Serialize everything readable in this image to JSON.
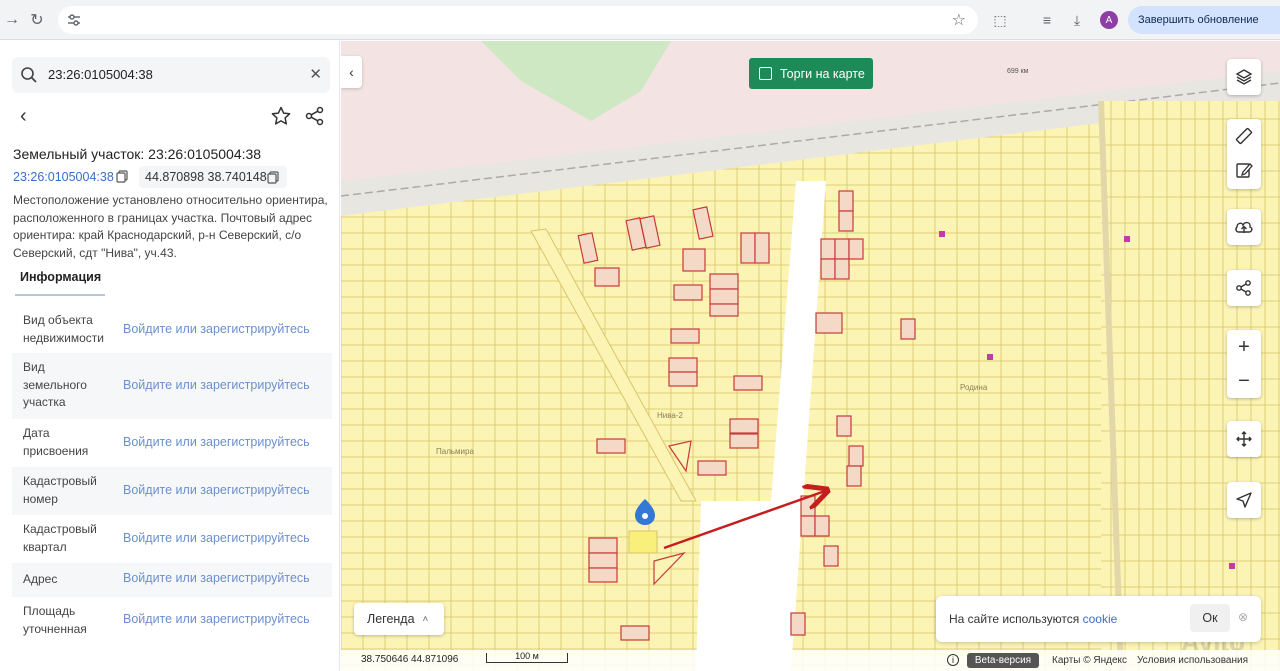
{
  "browser": {
    "update_button": "Завершить обновление",
    "avatar_letter": "A"
  },
  "panel": {
    "search_query": "23:26:0105004:38",
    "title": "Земельный участок: 23:26:0105004:38",
    "cadastral_link": "23:26:0105004:38",
    "coordinates": "44.870898 38.740148",
    "description": "Местоположение установлено относительно ориентира, расположенного в границах участка. Почтовый адрес ориентира: край Краснодарский, р-н Северский, с/о Северский, сдт \"Нива\", уч.43.",
    "tab_info": "Информация",
    "rows": [
      {
        "label": "Вид объекта недвижимости",
        "value": "Войдите или зарегистрируйтесь"
      },
      {
        "label": "Вид земельного участка",
        "value": "Войдите или зарегистрируйтесь"
      },
      {
        "label": "Дата присвоения",
        "value": "Войдите или зарегистрируйтесь"
      },
      {
        "label": "Кадастровый номер",
        "value": "Войдите или зарегистрируйтесь"
      },
      {
        "label": "Кадастровый квартал",
        "value": "Войдите или зарегистрируйтесь"
      },
      {
        "label": "Адрес",
        "value": "Войдите или зарегистрируйтесь"
      },
      {
        "label": "Площадь уточненная",
        "value": "Войдите или зарегистрируйтесь"
      }
    ]
  },
  "map": {
    "auction_label": "Торги на карте",
    "legend_label": "Легенда",
    "place_labels": [
      "Нива-2",
      "Пальмира",
      "Родина",
      "699 км"
    ],
    "cookie_text": "На сайте используются",
    "cookie_link": "cookie",
    "cookie_ok": "Ок",
    "bottom_coords": "38.750646  44.871096",
    "scale_label": "100 м",
    "beta_label": "Beta-версия",
    "copyright": "Карты © Яндекс",
    "terms": "Условия использования",
    "watermark": "Avito",
    "colors": {
      "parcel_fill": "#fbf4b4",
      "parcel_stroke": "#d9c56a",
      "highlight_stroke": "#c83a3a",
      "forest": "#cfe8c4",
      "arrow": "#c41e1e",
      "marker": "#3478d6"
    }
  }
}
